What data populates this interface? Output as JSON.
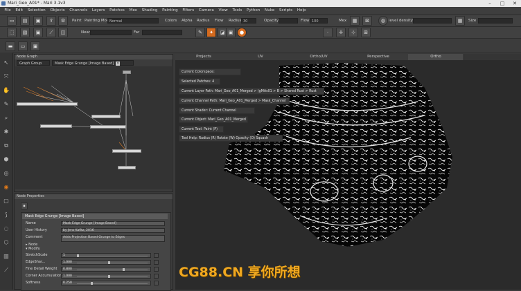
{
  "window": {
    "title": "Mari_Geo_A01* - Mari 3.1v3"
  },
  "menu": [
    "File",
    "Edit",
    "Selection",
    "Objects",
    "Channels",
    "Layers",
    "Patches",
    "Mex",
    "Shading",
    "Painting",
    "Filters",
    "Camera",
    "View",
    "Tools",
    "Python",
    "Nuke",
    "Scripts",
    "Help"
  ],
  "toolbar1": {
    "paint_label": "Paint",
    "painting_mode_label": "Painting Mode",
    "painting_mode_value": "Normal",
    "colors_label": "Colors",
    "alpha_label": "Alpha",
    "radius_label": "Radius",
    "flow_label": "Flow",
    "radius2_label": "Radius",
    "radius_value": "30",
    "opacity_label": "Opacity",
    "flow2_label": "Flow",
    "flow_value": "100",
    "mex_label": "Mex",
    "level_density_label": "level density",
    "size_label": "Size"
  },
  "toolbar2": {
    "near_label": "Near",
    "far_label": "Far"
  },
  "node_graph": {
    "header": "Node Graph",
    "tabs": [
      {
        "label": "Graph Group"
      },
      {
        "label": "Mask Edge Grunge [Image Based]"
      }
    ]
  },
  "node_properties": {
    "header": "Node Properties",
    "section_title": "Mask Edge Grunge [Image Based]",
    "rows": [
      {
        "label": "Name",
        "value": "Mask Edge Grunge [Image Based]"
      },
      {
        "label": "User History",
        "value": "by Jens Kafitz, 2016"
      },
      {
        "label": "Comment",
        "value": "Adds Projection Based Grunge to Edges"
      }
    ],
    "groups": [
      "Node",
      "Modify"
    ],
    "sliders": [
      {
        "label": "StretchScale",
        "value": "1",
        "fraction": 0.0
      },
      {
        "label": "EdgeShar...",
        "value": "1.000",
        "fraction": 0.45
      },
      {
        "label": "Fine Detail Weight",
        "value": "0.800",
        "fraction": 0.65
      },
      {
        "label": "Corner Accumulation",
        "value": "1.000",
        "fraction": 0.45
      },
      {
        "label": "Softness",
        "value": "0.250",
        "fraction": 0.2
      }
    ]
  },
  "viewport": {
    "tabs": [
      "Projects",
      "UV",
      "Ortho/UV",
      "Perspective",
      "Ortho"
    ],
    "active_tab": "Ortho",
    "hud": [
      "Current Colorspace:",
      "Selected Patches: 4",
      "Current Layer Path: Mari_Geo_A01_Merged > (gMAs01 > B > Shared Rust > Rust",
      "Current Channel Path: Mari_Geo_A01_Merged > Mask_Channel",
      "Current Shader: Current Channel",
      "Current Object: Mari_Geo_A01_Merged",
      "Current Tool: Paint (P)",
      "Tool Help:  Radius (R)  Rotate (W)  Opacity (O)  Squash"
    ]
  },
  "watermark": "CG88.CN 享你所想"
}
